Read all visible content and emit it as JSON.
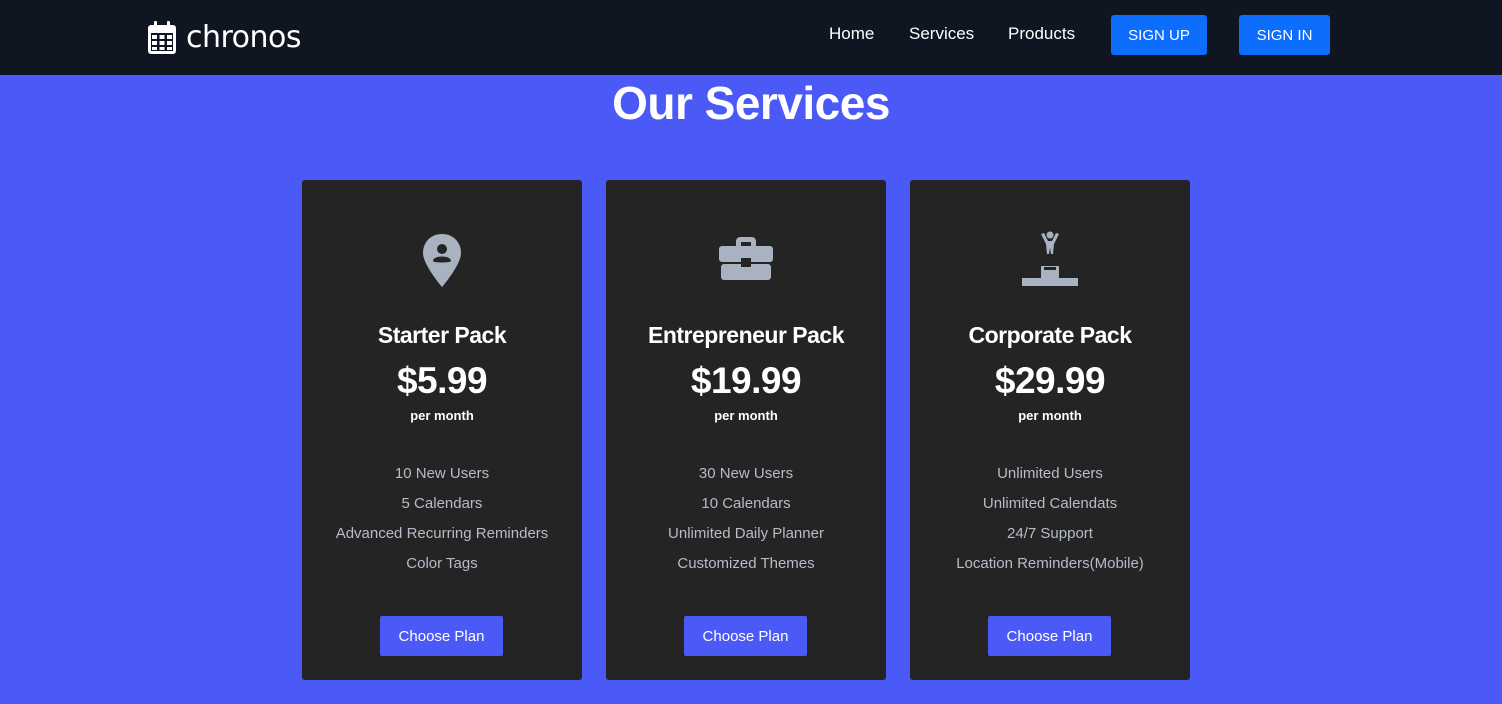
{
  "navbar": {
    "brand_name": "chronos",
    "brand_icon": "calendar-icon",
    "links": [
      "Home",
      "Services",
      "Products"
    ],
    "signup_label": "SIGN UP",
    "signin_label": "SIGN IN"
  },
  "page": {
    "title": "Our Services"
  },
  "plans": [
    {
      "icon": "location-user-icon",
      "name": "Starter Pack",
      "price": "$5.99",
      "period": "per month",
      "features": [
        "10 New Users",
        "5 Calendars",
        "Advanced Recurring Reminders",
        "Color Tags"
      ],
      "button_label": "Choose Plan"
    },
    {
      "icon": "briefcase-icon",
      "name": "Entrepreneur Pack",
      "price": "$19.99",
      "period": "per month",
      "features": [
        "30 New Users",
        "10 Calendars",
        "Unlimited Daily Planner",
        "Customized Themes"
      ],
      "button_label": "Choose Plan"
    },
    {
      "icon": "podium-winner-icon",
      "name": "Corporate Pack",
      "price": "$29.99",
      "period": "per month",
      "features": [
        "Unlimited Users",
        "Unlimited Calendats",
        "24/7 Support",
        "Location Reminders(Mobile)"
      ],
      "button_label": "Choose Plan"
    }
  ],
  "colors": {
    "navbar_bg": "#0f1521",
    "page_bg": "#4b5af7",
    "card_bg": "#242424",
    "primary_button": "#0d6efd",
    "icon_gray": "#a9b2c0"
  }
}
